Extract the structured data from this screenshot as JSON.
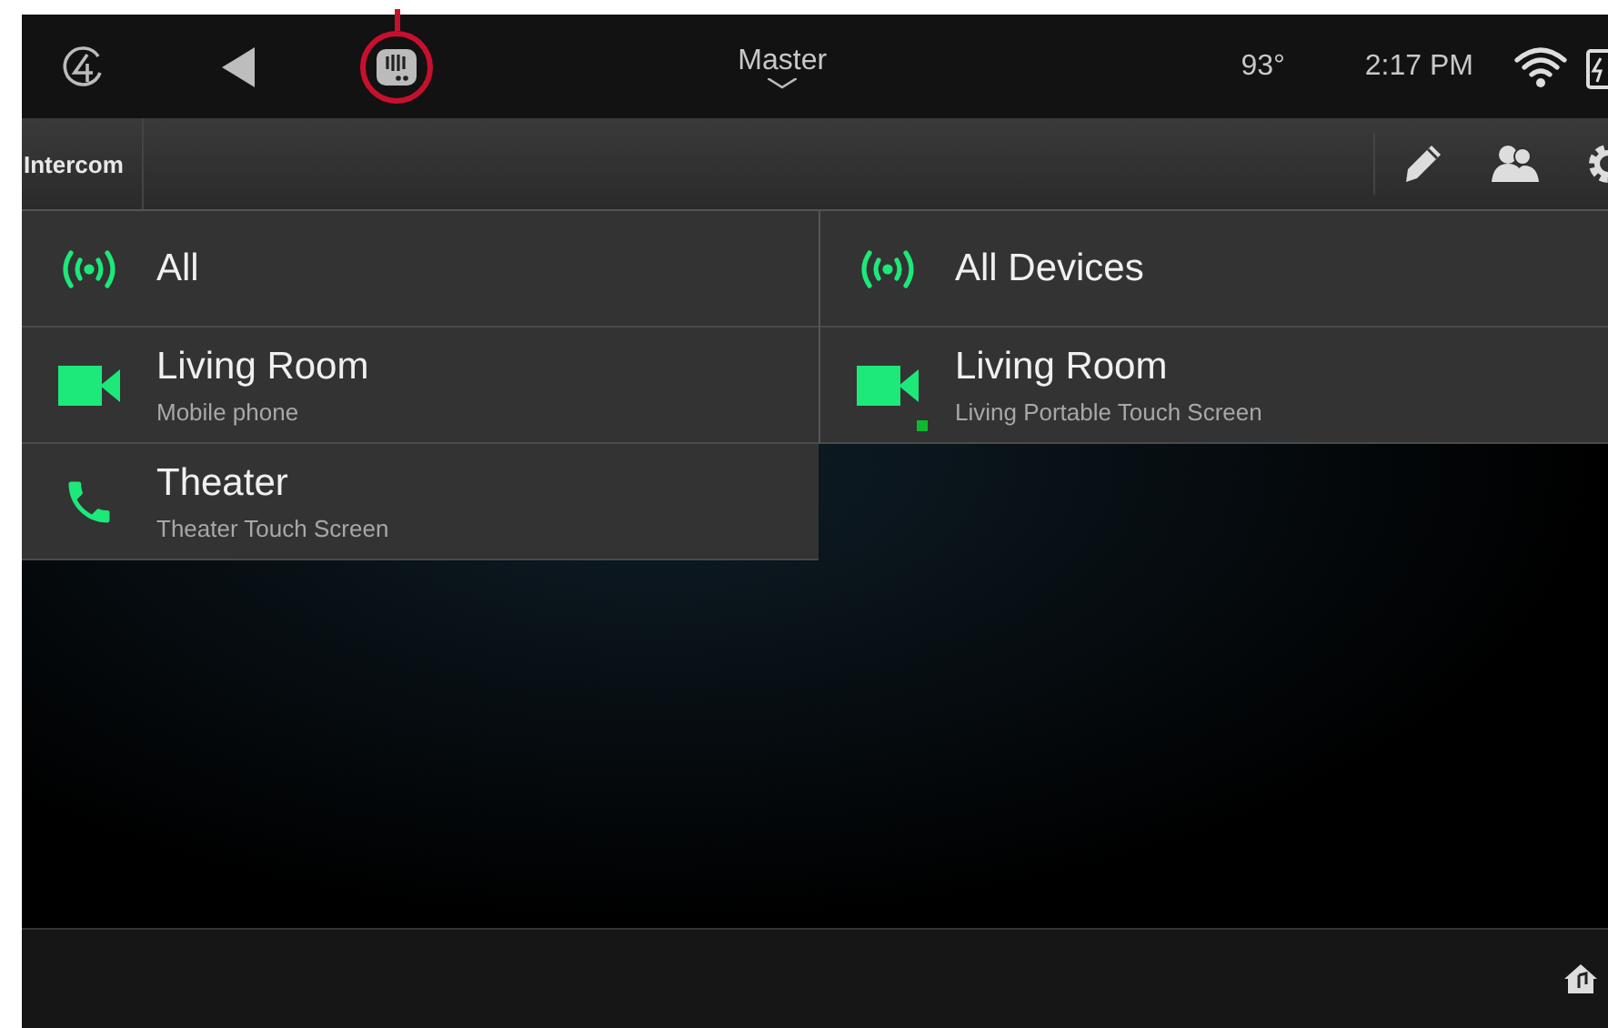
{
  "top_bar": {
    "room": "Master",
    "temperature": "93°",
    "time": "2:17 PM"
  },
  "toolbar": {
    "title": "Intercom"
  },
  "columns": [
    {
      "items": [
        {
          "kind": "broadcast",
          "title": "All",
          "online": false
        },
        {
          "kind": "video",
          "title": "Living Room",
          "subtitle": "Mobile phone",
          "online": false
        },
        {
          "kind": "phone",
          "title": "Theater",
          "subtitle": "Theater Touch Screen",
          "online": false
        }
      ]
    },
    {
      "items": [
        {
          "kind": "broadcast",
          "title": "All Devices",
          "online": false
        },
        {
          "kind": "video",
          "title": "Living Room",
          "subtitle": "Living Portable Touch Screen",
          "online": true
        }
      ]
    }
  ]
}
